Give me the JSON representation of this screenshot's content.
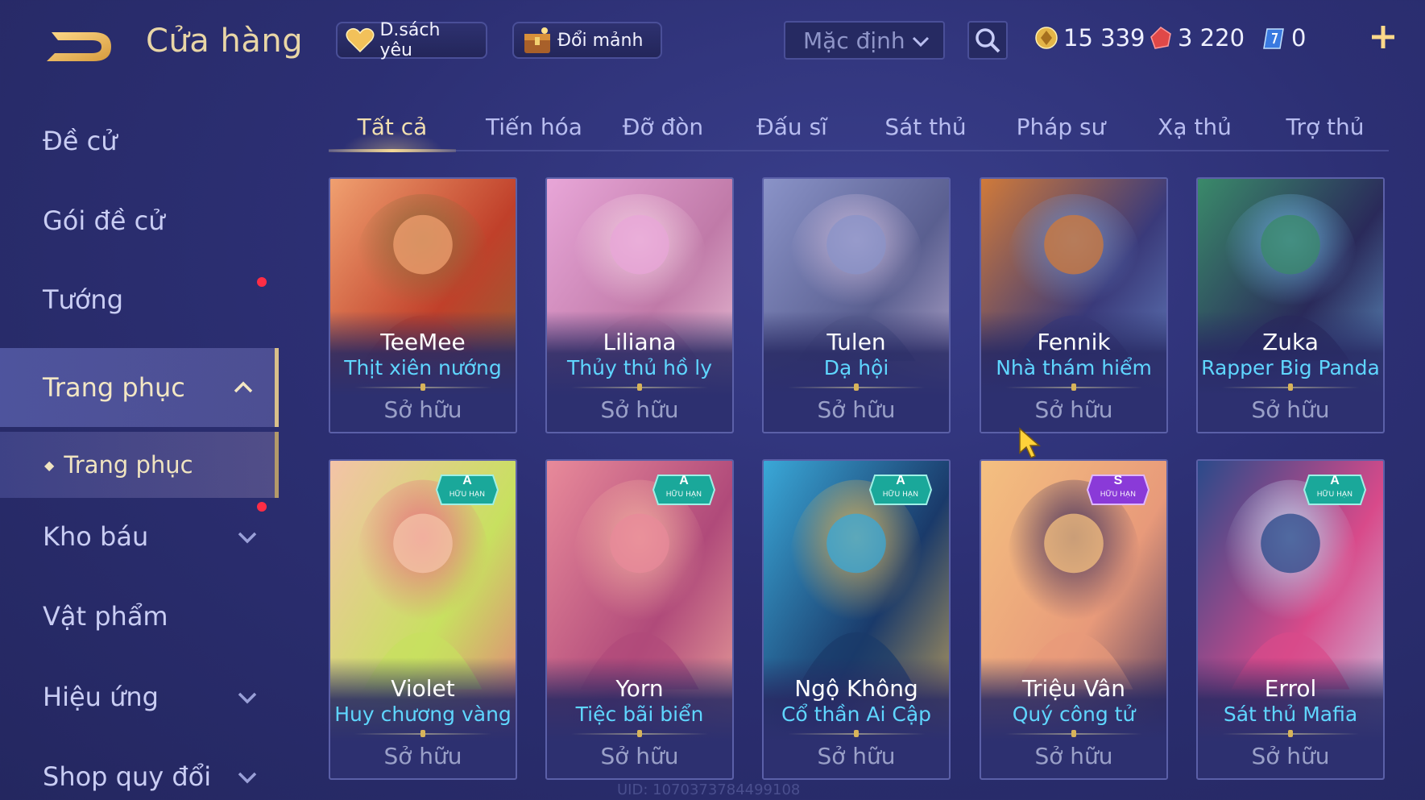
{
  "header": {
    "title": "Cửa hàng",
    "favorites_label": "D.sách yêu",
    "fragments_label": "Đổi mảnh",
    "sort_value": "Mặc định",
    "currency": {
      "gold": "15 339",
      "ruby": "3 220",
      "voucher": "0"
    }
  },
  "sidebar": {
    "items": [
      {
        "label": "Đề cử"
      },
      {
        "label": "Gói đề cử"
      },
      {
        "label": "Tướng"
      },
      {
        "label": "Trang phục"
      },
      {
        "label": "Trang phục"
      },
      {
        "label": "Kho báu"
      },
      {
        "label": "Vật phẩm"
      },
      {
        "label": "Hiệu ứng"
      },
      {
        "label": "Shop quy đổi"
      }
    ]
  },
  "tabs": [
    "Tất cả",
    "Tiến hóa",
    "Đỡ đòn",
    "Đấu sĩ",
    "Sát thủ",
    "Pháp sư",
    "Xạ thủ",
    "Trợ thủ"
  ],
  "cards": [
    {
      "hero": "TeeMee",
      "skin": "Thịt xiên nướng",
      "status": "Sở hữu",
      "colors": [
        "#f0a070",
        "#c0402a",
        "#8a6a3a"
      ]
    },
    {
      "hero": "Liliana",
      "skin": "Thủy thủ hồ ly",
      "status": "Sở hữu",
      "colors": [
        "#e8a6d8",
        "#c07aa8",
        "#f2d0e0"
      ]
    },
    {
      "hero": "Tulen",
      "skin": "Dạ hội",
      "status": "Sở hữu",
      "colors": [
        "#8a93c8",
        "#5a5f90",
        "#c8b8d8"
      ]
    },
    {
      "hero": "Fennik",
      "skin": "Nhà thám hiểm",
      "status": "Sở hữu",
      "colors": [
        "#d07a3a",
        "#3a3a7a",
        "#6a8ac8"
      ]
    },
    {
      "hero": "Zuka",
      "skin": "Rapper Big Panda",
      "status": "Sở hữu",
      "colors": [
        "#3a8a6a",
        "#2a2a5a",
        "#6aa8d8"
      ]
    },
    {
      "hero": "Violet",
      "skin": "Huy chương vàng",
      "status": "Sở hữu",
      "tier": "A",
      "tier_label": "HỮU HẠN",
      "colors": [
        "#f4c3a8",
        "#c8e060",
        "#e86a80"
      ]
    },
    {
      "hero": "Yorn",
      "skin": "Tiệc bãi biển",
      "status": "Sở hữu",
      "tier": "A",
      "tier_label": "HỮU HẠN",
      "colors": [
        "#e88a9a",
        "#b04a7a",
        "#f2b0a0"
      ]
    },
    {
      "hero": "Ngộ Không",
      "skin": "Cổ thần Ai Cập",
      "status": "Sở hữu",
      "tier": "A",
      "tier_label": "HỮU HẠN",
      "colors": [
        "#3aa8d8",
        "#1a3a6a",
        "#d8b05a"
      ]
    },
    {
      "hero": "Triệu Vân",
      "skin": "Quý công tử",
      "status": "Sở hữu",
      "tier": "S",
      "tier_label": "HỮU HẠN",
      "colors": [
        "#f4c080",
        "#e89a7a",
        "#3a2a5a"
      ]
    },
    {
      "hero": "Errol",
      "skin": "Sát thủ Mafia",
      "status": "Sở hữu",
      "tier": "A",
      "tier_label": "HỮU HẠN",
      "colors": [
        "#2a4a8a",
        "#d84a8a",
        "#c8d8f0"
      ]
    }
  ],
  "footer": {
    "uid": "UID: 1070373784499108"
  }
}
